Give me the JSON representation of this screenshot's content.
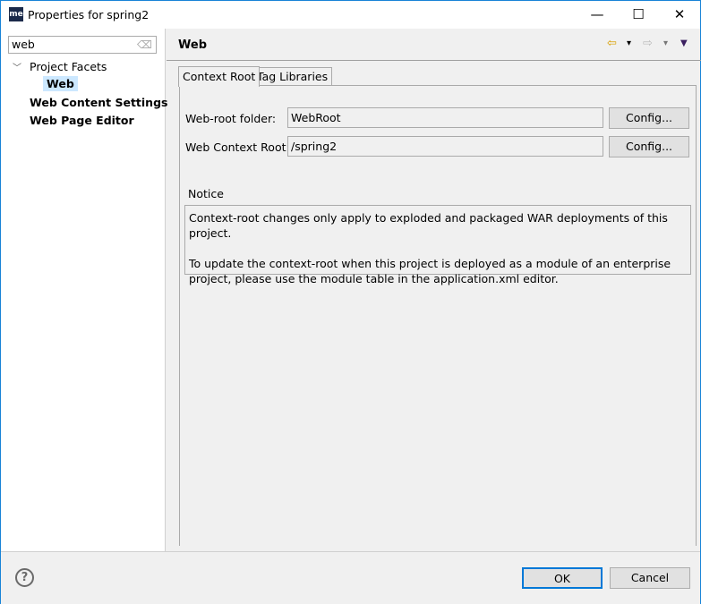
{
  "window": {
    "title": "Properties for spring2",
    "app_icon": "me",
    "minimize": "—",
    "maximize": "☐",
    "close": "✕"
  },
  "sidebar": {
    "filter_value": "web",
    "tree": [
      {
        "label": "Project Facets",
        "expanded": true
      },
      {
        "label": "Web",
        "selected": true
      },
      {
        "label": "Web Content Settings"
      },
      {
        "label": "Web Page Editor"
      }
    ]
  },
  "page": {
    "title": "Web",
    "nav": {
      "back": "⇦",
      "forward": "⇨",
      "dropdown": "▾",
      "menu": "▼"
    },
    "tabs": [
      {
        "label": "Context Root",
        "active": true
      },
      {
        "label": "Tag Libraries"
      }
    ],
    "web_root_label": "Web-root folder:",
    "web_root_value": "WebRoot",
    "context_root_label": "Web Context Root:",
    "context_root_value": "/spring2",
    "config_label": "Config...",
    "notice_title": "Notice",
    "notice_line1": "Context-root changes only apply to exploded and packaged WAR deployments of this project.",
    "notice_line2": "To update the context-root when this project is deployed as a module of an enterprise project, please use the module table in the application.xml editor."
  },
  "footer": {
    "help": "?",
    "ok": "OK",
    "cancel": "Cancel"
  }
}
